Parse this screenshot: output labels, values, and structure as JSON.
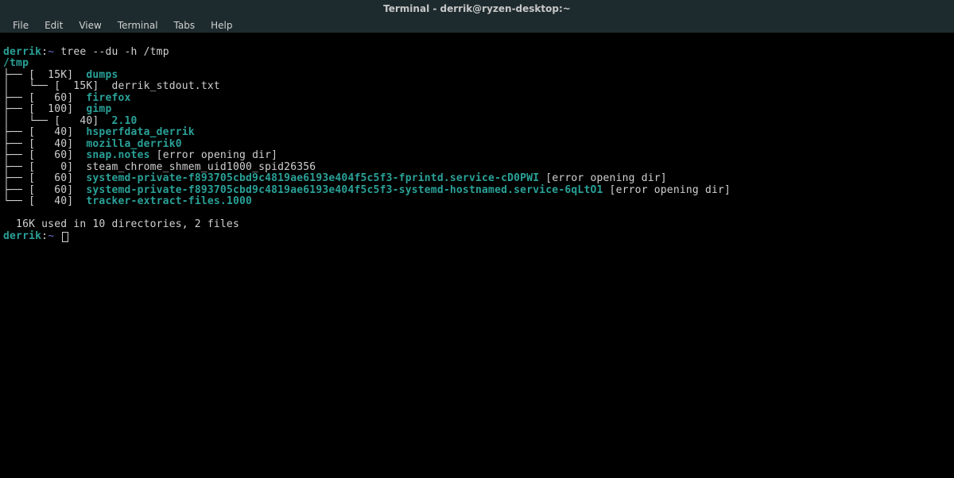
{
  "window": {
    "title": "Terminal - derrik@ryzen-desktop:~"
  },
  "menu": {
    "file": "File",
    "edit": "Edit",
    "view": "View",
    "terminal": "Terminal",
    "tabs": "Tabs",
    "help": "Help"
  },
  "prompt": {
    "user": "derrik",
    "sep": ":",
    "path": "~",
    "command": "tree --du -h /tmp"
  },
  "tree": {
    "root": "/tmp",
    "lines": {
      "l0": "├── [  15K]  ",
      "n0": "dumps",
      "l1": "│   └── [  15K]  derrik_stdout.txt",
      "l2": "├── [   60]  ",
      "n2": "firefox",
      "l3": "├── [  100]  ",
      "n3": "gimp",
      "l4": "│   └── [   40]  ",
      "n4": "2.10",
      "l5": "├── [   40]  ",
      "n5": "hsperfdata_derrik",
      "l6": "├── [   40]  ",
      "n6": "mozilla_derrik0",
      "l7": "├── [   60]  ",
      "n7": "snap.notes",
      "e7": " [error opening dir]",
      "l8": "├── [    0]  steam_chrome_shmem_uid1000_spid26356",
      "l9": "├── [   60]  ",
      "n9": "systemd-private-f893705cbd9c4819ae6193e404f5c5f3-fprintd.service-cD0PWI",
      "e9": " [error opening dir]",
      "l10": "├── [   60]  ",
      "n10": "systemd-private-f893705cbd9c4819ae6193e404f5c5f3-systemd-hostnamed.service-6qLtO1",
      "e10": " [error opening dir]",
      "l11": "└── [   40]  ",
      "n11": "tracker-extract-files.1000"
    },
    "summary": "  16K used in 10 directories, 2 files"
  },
  "prompt2": {
    "user": "derrik",
    "sep": ":",
    "path": "~"
  }
}
